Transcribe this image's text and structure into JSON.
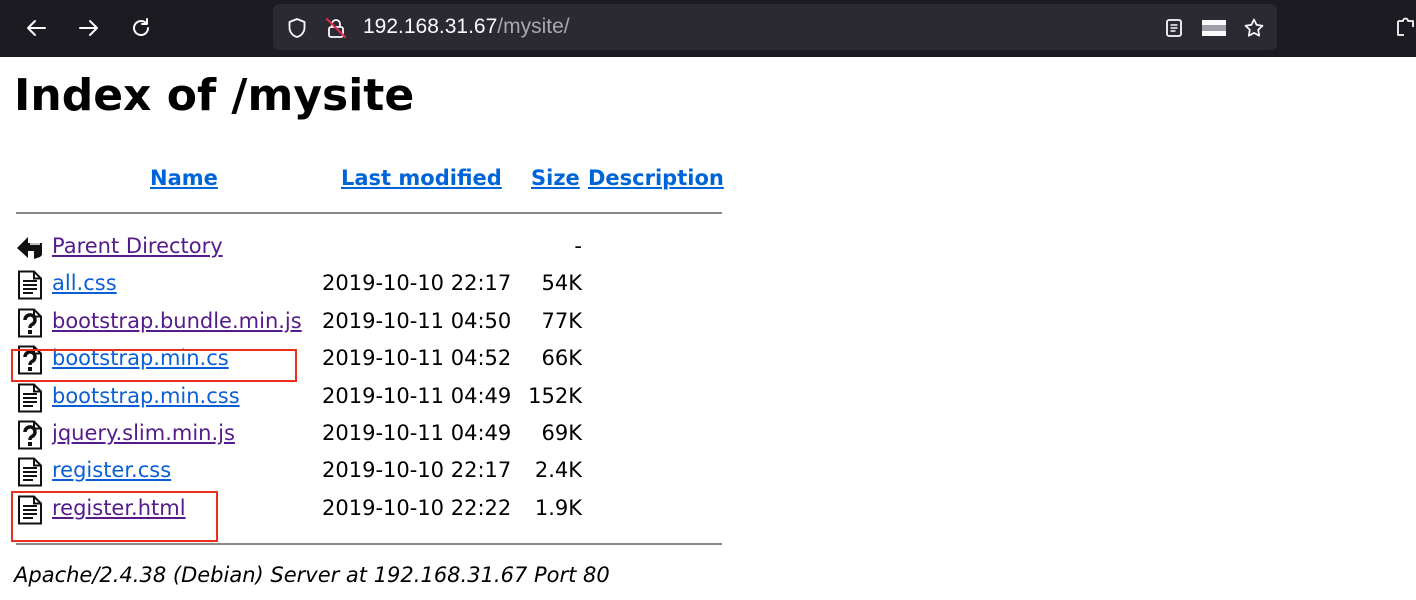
{
  "browser": {
    "url_host": "192.168.31.67",
    "url_path": "/mysite/",
    "icons": {
      "back": "arrow-left-icon",
      "forward": "arrow-right-icon",
      "reload": "reload-icon",
      "shield": "shield-icon",
      "insecure_lock": "insecure-lock-icon",
      "reader": "reader-view-icon",
      "bookmark": "star-icon",
      "extensions": "puzzle-icon"
    }
  },
  "page": {
    "title": "Index of /mysite",
    "columns": {
      "name": "Name",
      "last_modified": "Last modified",
      "size": "Size",
      "description": "Description"
    },
    "rows": [
      {
        "name": "Parent Directory",
        "modified": "",
        "size": "-",
        "icon": "back-folder-icon",
        "visited": true
      },
      {
        "name": "all.css",
        "modified": "2019-10-10 22:17",
        "size": "54K",
        "icon": "text-file-icon",
        "visited": false
      },
      {
        "name": "bootstrap.bundle.min.js",
        "modified": "2019-10-11 04:50",
        "size": "77K",
        "icon": "unknown-file-icon",
        "visited": true
      },
      {
        "name": "bootstrap.min.cs",
        "modified": "2019-10-11 04:52",
        "size": "66K",
        "icon": "unknown-file-icon",
        "visited": false
      },
      {
        "name": "bootstrap.min.css",
        "modified": "2019-10-11 04:49",
        "size": "152K",
        "icon": "text-file-icon",
        "visited": false
      },
      {
        "name": "jquery.slim.min.js",
        "modified": "2019-10-11 04:49",
        "size": "69K",
        "icon": "unknown-file-icon",
        "visited": true
      },
      {
        "name": "register.css",
        "modified": "2019-10-10 22:17",
        "size": "2.4K",
        "icon": "text-file-icon",
        "visited": false
      },
      {
        "name": "register.html",
        "modified": "2019-10-10 22:22",
        "size": "1.9K",
        "icon": "text-file-icon",
        "visited": true
      }
    ],
    "address": "Apache/2.4.38 (Debian) Server at 192.168.31.67 Port 80"
  },
  "colors": {
    "toolbar_bg": "#1c1b22",
    "urlbar_bg": "#2b2a33",
    "link": "#0b5fd6",
    "visited": "#551a8b",
    "annotation": "#e8301c"
  }
}
